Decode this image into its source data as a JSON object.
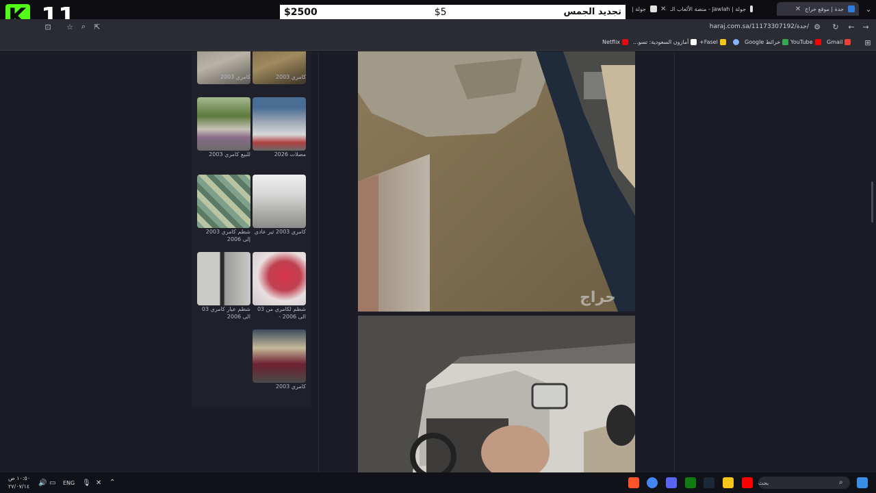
{
  "tabs": [
    {
      "title": "جدة | موقع حراج",
      "favicon_color": "#2f7de1",
      "active": true
    },
    {
      "title": "جولة | Jawlah - منصة الألعاب الـ",
      "favicon_color": "#e0e0e0",
      "active": false
    },
    {
      "title": "جولة |",
      "favicon_color": "#e0e0e0",
      "active": false
    }
  ],
  "overlay": {
    "price": "$2500",
    "amount": "$5",
    "title": "تجديد الجمس"
  },
  "stream": {
    "logo_letter": "K",
    "number": "11",
    "brand_color": "#53fc18"
  },
  "address": {
    "url": "haraj.com.sa/11173307192/جدة/"
  },
  "bookmarks": [
    {
      "label": "Gmail",
      "icon_color": "#ea4335"
    },
    {
      "label": "YouTube",
      "icon_color": "#ff0000"
    },
    {
      "label": "خرائط Google",
      "icon_color": "#34a853"
    },
    {
      "label": "",
      "icon_color": "#8ab4f8"
    },
    {
      "label": "Fasel+",
      "icon_color": "#f5c518"
    },
    {
      "label": "أمازون السعودية: تسو...",
      "icon_color": "#ffffff"
    },
    {
      "label": "Netflix",
      "icon_color": "#e50914"
    }
  ],
  "listings": [
    {
      "label": "كامري 2003",
      "colors": [
        "#8a8478",
        "#b9b3a6",
        "#5c5a55"
      ]
    },
    {
      "label": "كامري 2003",
      "colors": [
        "#6b5a3e",
        "#a08a5e",
        "#3d3527"
      ]
    },
    {
      "label": "للبيع كامري 2003",
      "colors": [
        "#5e7a3c",
        "#c7c2b8",
        "#8a6d8a"
      ]
    },
    {
      "label": "مصلات 2026",
      "colors": [
        "#4a6d94",
        "#d8d8d8",
        "#b04040"
      ]
    },
    {
      "label": "شطم كامري 2003 إلى 2006",
      "colors": [
        "#7fa08a",
        "#b8c4a2",
        "#5a7a66"
      ]
    },
    {
      "label": "كامري 2003 ثير عادي",
      "colors": [
        "#d8d8d8",
        "#b4b4b0",
        "#8a8a88"
      ]
    },
    {
      "label": "شطم عيار كامري 03 الى 2006",
      "colors": [
        "#c9c9c6",
        "#9a9a98",
        "#2a2a2a"
      ]
    },
    {
      "label": "شطم لكامري من 03 الى 2006 -",
      "colors": [
        "#d8334a",
        "#e8e0e0",
        "#c04050"
      ]
    },
    {
      "label": "كامري 2003",
      "colors": [
        "#6e2030",
        "#c4b89a",
        "#3d4a5c"
      ]
    }
  ],
  "main_photos": {
    "watermark": "حراج"
  },
  "taskbar": {
    "time": "١٠:٥٠ ص",
    "date": "٢٧/٠٧/١٤",
    "lang": "ENG",
    "search_placeholder": "بحث"
  }
}
